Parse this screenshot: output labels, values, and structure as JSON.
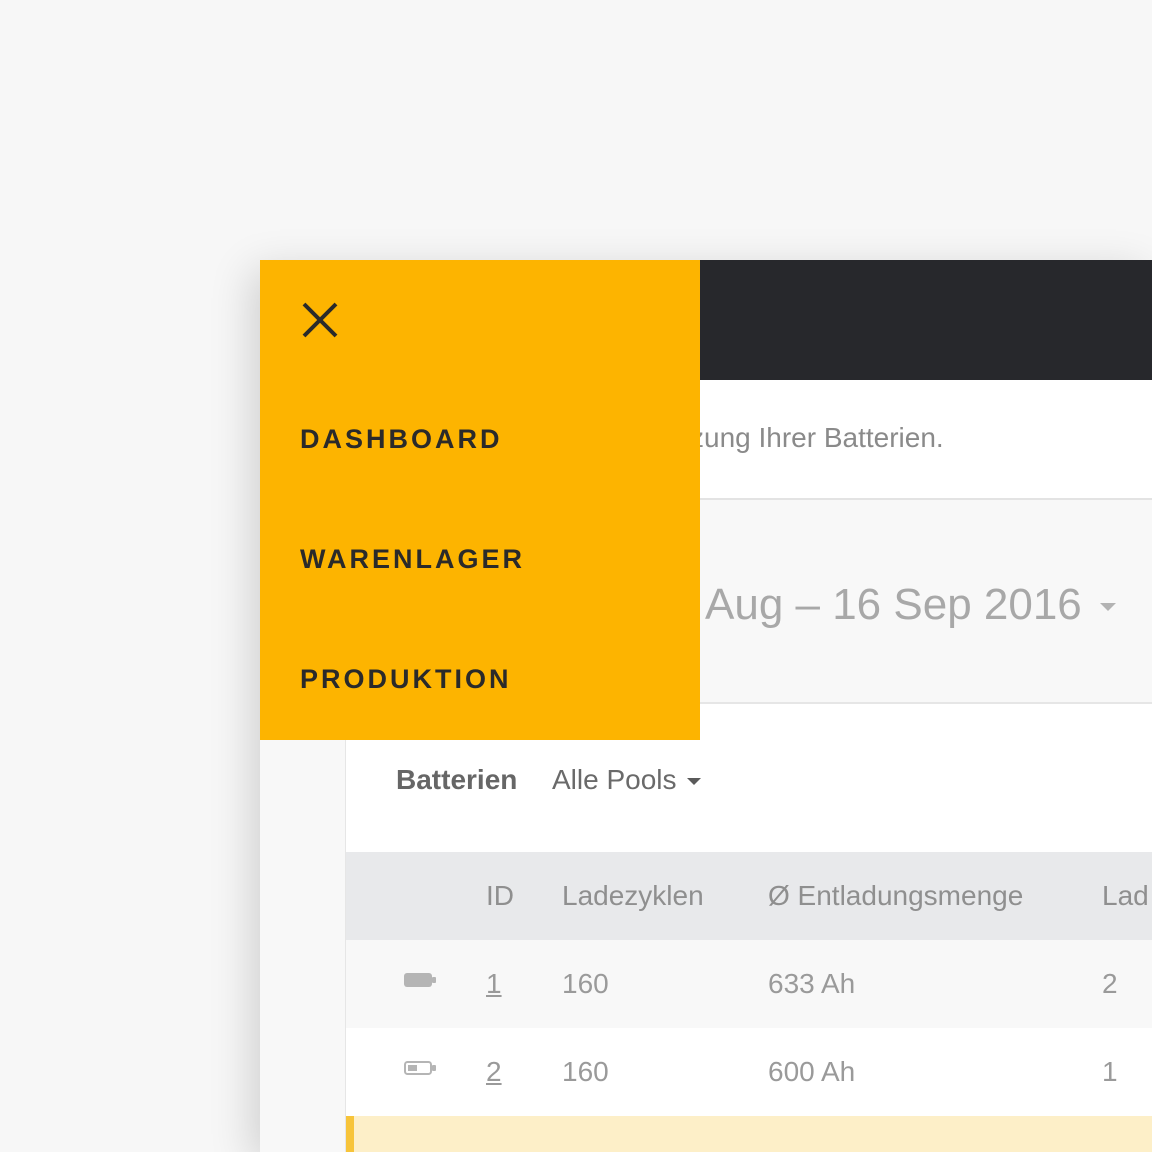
{
  "menu": {
    "close_icon": "close-icon",
    "items": [
      {
        "label": "DASHBOARD"
      },
      {
        "label": "WARENLAGER"
      },
      {
        "label": "PRODUKTION"
      }
    ]
  },
  "intro": {
    "text": "zung Ihrer Batterien."
  },
  "period": {
    "text": "Aug – 16 Sep 2016"
  },
  "card": {
    "title": "Batterien",
    "pool_select": "Alle Pools"
  },
  "table": {
    "columns": [
      "ID",
      "Ladezyklen",
      "Ø Entladungsmenge",
      "Lad"
    ],
    "rows": [
      {
        "status_icon": "battery-full-icon",
        "id": "1",
        "ladezyklen": "160",
        "entladung": "633 Ah",
        "lad": "2"
      },
      {
        "status_icon": "battery-low-icon",
        "id": "2",
        "ladezyklen": "160",
        "entladung": "600 Ah",
        "lad": "1"
      }
    ]
  },
  "colors": {
    "menu_bg": "#fdb400",
    "topbar_bg": "#27282c",
    "highlight_row_bg": "#fdefc8",
    "highlight_row_accent": "#f7c43a"
  }
}
